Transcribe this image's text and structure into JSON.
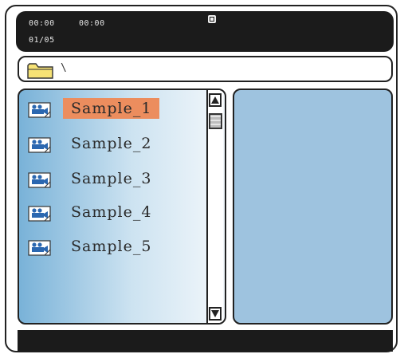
{
  "status": {
    "elapsed_time": "00:00",
    "total_time": "00:00",
    "file_counter": "01/05"
  },
  "path_bar": {
    "path": "\\"
  },
  "file_list": {
    "items": [
      {
        "label": "Sample_1",
        "selected": true
      },
      {
        "label": "Sample_2",
        "selected": false
      },
      {
        "label": "Sample_3",
        "selected": false
      },
      {
        "label": "Sample_4",
        "selected": false
      },
      {
        "label": "Sample_5",
        "selected": false
      }
    ]
  },
  "icons": {
    "state": "stop-icon",
    "folder": "folder-icon",
    "file": "video-file-icon",
    "scroll_up": "scroll-up-arrow-icon",
    "scroll_down": "scroll-down-arrow-icon"
  },
  "colors": {
    "bars": "#1b1b1b",
    "selection": "#ec8d5e",
    "preview": "#9ec3df",
    "list_gradient_start": "#79b2d8"
  }
}
